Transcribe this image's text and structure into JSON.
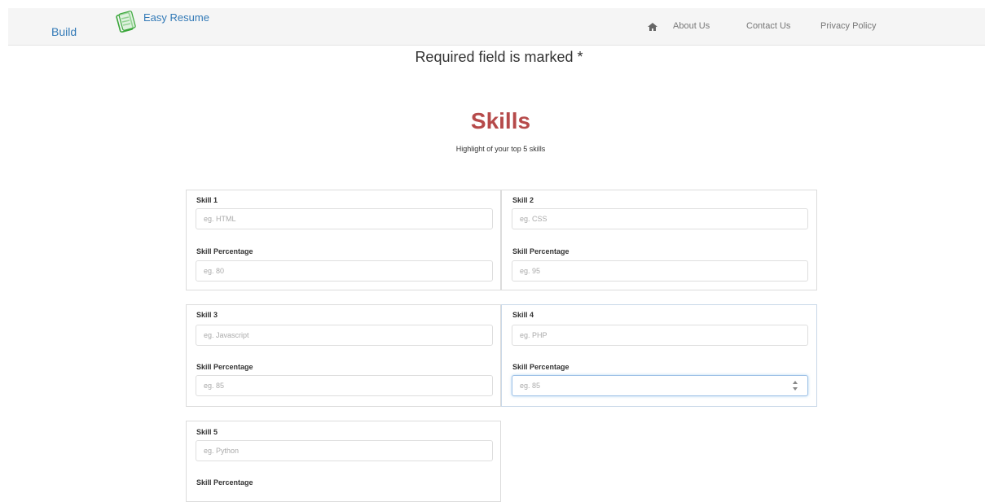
{
  "navbar": {
    "build_label": "Build",
    "brand_title": "Easy Resume",
    "links": [
      "About Us",
      "Contact Us",
      "Privacy Policy"
    ]
  },
  "required_note": "Required field is marked *",
  "section": {
    "title": "Skills",
    "subtitle": "Highlight of your top 5 skills"
  },
  "skills": [
    {
      "label": "Skill 1",
      "placeholder": "eg. HTML",
      "pct_label": "Skill Percentage",
      "pct_placeholder": "eg. 80"
    },
    {
      "label": "Skill 2",
      "placeholder": "eg. CSS",
      "pct_label": "Skill Percentage",
      "pct_placeholder": "eg. 95"
    },
    {
      "label": "Skill 3",
      "placeholder": "eg. Javascript",
      "pct_label": "Skill Percentage",
      "pct_placeholder": "eg. 85"
    },
    {
      "label": "Skill 4",
      "placeholder": "eg. PHP",
      "pct_label": "Skill Percentage",
      "pct_placeholder": "eg. 85"
    },
    {
      "label": "Skill 5",
      "placeholder": "eg. Python",
      "pct_label": "Skill Percentage",
      "pct_placeholder": ""
    }
  ],
  "colors": {
    "link": "#337ab7",
    "title": "#b64a4a",
    "navbar_bg": "#f5f5f5"
  }
}
